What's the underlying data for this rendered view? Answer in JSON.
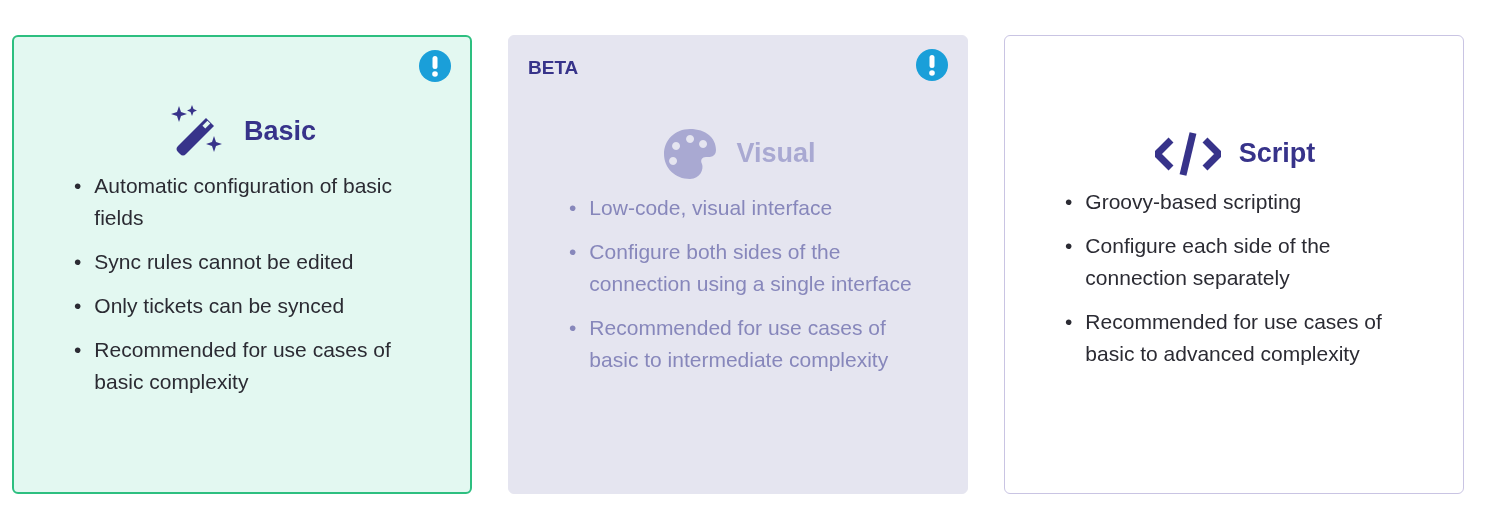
{
  "cards": [
    {
      "title": "Basic",
      "kind": "wand",
      "selected": true,
      "disabled": false,
      "info": true,
      "features": [
        {
          "bullet": "•",
          "text": "Automatic configuration of basic fields"
        },
        {
          "bullet": "•",
          "text": "Sync rules cannot be edited"
        },
        {
          "bullet": "•",
          "text": "Only tickets can be synced"
        },
        {
          "bullet": "•",
          "text": "Recommended for use cases of basic complexity"
        }
      ]
    },
    {
      "title": "Visual",
      "kind": "palette",
      "badge": "BETA",
      "selected": false,
      "disabled": true,
      "info": true,
      "features": [
        {
          "bullet": "•",
          "text": "Low-code, visual interface"
        },
        {
          "bullet": "•",
          "text": "Configure both sides of the connection using a single interface"
        },
        {
          "bullet": "•",
          "text": "Recommended for use cases of basic to intermediate complexity"
        }
      ]
    },
    {
      "title": "Script",
      "kind": "code",
      "selected": false,
      "disabled": false,
      "info": false,
      "features": [
        {
          "bullet": "•",
          "text": "Groovy-based scripting"
        },
        {
          "bullet": "•",
          "text": "Configure each side of the connection separately"
        },
        {
          "bullet": "•",
          "text": "Recommended for use cases of basic to advanced complexity"
        }
      ]
    }
  ]
}
